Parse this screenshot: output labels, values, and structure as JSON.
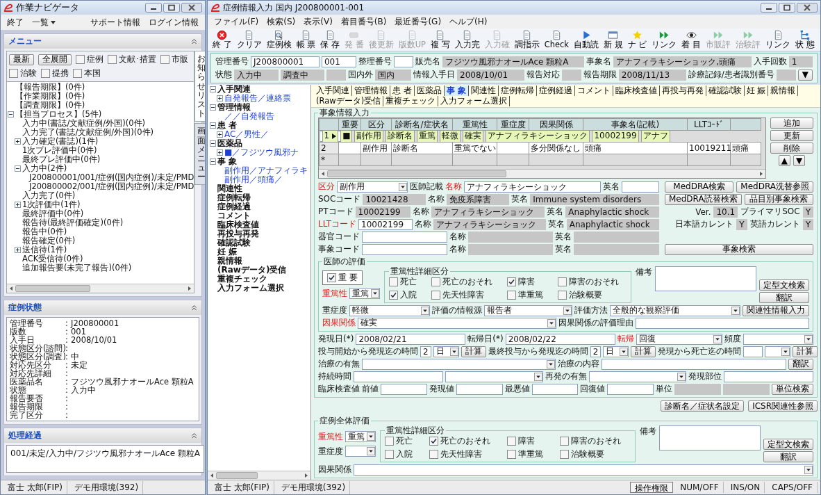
{
  "nav_window": {
    "title": "作業ナビゲータ",
    "menu": [
      {
        "kind": "item",
        "text": "終了"
      },
      {
        "kind": "dropdown",
        "text": "一覧"
      }
    ],
    "links": [
      "サポート情報",
      "ログイン情報"
    ],
    "menu_panel": {
      "title": "メニュー",
      "buttons": [
        "最新",
        "全展開"
      ],
      "filters": [
        {
          "label": "症例",
          "checked": false
        },
        {
          "label": "文献･措置",
          "checked": false
        },
        {
          "label": "市販",
          "checked": false
        },
        {
          "label": "治験",
          "checked": false
        },
        {
          "label": "提携",
          "checked": false
        },
        {
          "label": "本国",
          "checked": false
        }
      ],
      "side_tabs": [
        {
          "label": "お知らせリスト",
          "selected": true
        },
        {
          "label": "画面メニュー",
          "selected": false
        }
      ],
      "tree": [
        {
          "kind": "leaf",
          "text": "【報告期限】(0件)"
        },
        {
          "kind": "leaf",
          "text": "【作業期限】(0件)"
        },
        {
          "kind": "leaf",
          "text": "【調査期限】(0件)"
        },
        {
          "kind": "node",
          "text": "【担当プロセス】(5件)",
          "expanded": true,
          "children": [
            {
              "kind": "leaf",
              "text": "入力中(書誌/文献症例/外国)(0件)"
            },
            {
              "kind": "leaf",
              "text": "入力完了(書誌/文献症例/外国)(0件)"
            },
            {
              "kind": "node",
              "text": "入力確定(書誌)(1件)",
              "expanded": false
            },
            {
              "kind": "leaf",
              "text": "1次プレ評価中(0件)"
            },
            {
              "kind": "leaf",
              "text": "最終プレ評価中(0件)"
            },
            {
              "kind": "node",
              "text": "入力中(2件)",
              "expanded": true,
              "children": [
                {
                  "kind": "leaf",
                  "text": "J200800001/001/症例(国内症例)/未定/PMD"
                },
                {
                  "kind": "leaf",
                  "text": "J200800002/001/症例(国内症例)/未定/PMD"
                }
              ]
            },
            {
              "kind": "leaf",
              "text": "入力完了(0件)"
            },
            {
              "kind": "node",
              "text": "1次評価中(1件)",
              "expanded": false
            },
            {
              "kind": "leaf",
              "text": "最終評価中(0件)"
            },
            {
              "kind": "leaf",
              "text": "報告待(最終評価確定)(0件)"
            },
            {
              "kind": "leaf",
              "text": "報告中(0件)"
            },
            {
              "kind": "leaf",
              "text": "報告確定(0件)"
            },
            {
              "kind": "node",
              "text": "送信待(1件)",
              "expanded": false
            },
            {
              "kind": "leaf",
              "text": "ACK受信待(0件)"
            },
            {
              "kind": "leaf",
              "text": "追加報告要(未完了報告)(0件)"
            }
          ]
        }
      ]
    },
    "case_status": {
      "title": "症例状態",
      "rows": [
        {
          "label": "管理番号",
          "sep": ":",
          "value": "J200800001"
        },
        {
          "label": "版数",
          "sep": ":",
          "value": "001"
        },
        {
          "label": "入手日",
          "sep": ":",
          "value": "2008/10/01"
        },
        {
          "label": "状態区分(諮問)",
          "sep": ":"
        },
        {
          "label": "状態区分(調査)",
          "sep": ":",
          "value": "中"
        },
        {
          "label": "対応先区分",
          "sep": ":",
          "value": "未定"
        },
        {
          "label": "対応先詳細",
          "sep": ":"
        },
        {
          "label": "医薬品名",
          "sep": ":",
          "value": "フジツウ風邪ナオールAce 顆粒A"
        },
        {
          "label": "状態",
          "sep": ":",
          "value": "入力中"
        },
        {
          "label": "報告要否",
          "sep": ":"
        },
        {
          "label": "報告期限",
          "sep": ":"
        },
        {
          "label": "完了区分",
          "sep": ":"
        }
      ]
    },
    "history": {
      "title": "処理経過",
      "lines": [
        "001/未定/入力中/フジツウ風邪ナオールAce 顆粒A"
      ]
    },
    "status_bar": [
      "富士 太郎(FIP)",
      "デモ用環境(392)"
    ]
  },
  "entry_window": {
    "title": "症例情報入力 国内 J200800001-001",
    "menu": [
      "ファイル(F)",
      "検索(S)",
      "表示(V)",
      "着目番号(B)",
      "最近番号(G)",
      "ヘルプ(H)"
    ],
    "toolbar": [
      {
        "label": "終 了",
        "disabled": false
      },
      {
        "label": "クリア",
        "disabled": false
      },
      {
        "label": "症例検",
        "disabled": false
      },
      {
        "label": "帳 票",
        "disabled": false
      },
      {
        "label": "保 存",
        "disabled": false
      },
      {
        "label": "発 番",
        "disabled": true
      },
      {
        "label": "後更新",
        "disabled": true
      },
      {
        "label": "版数UP",
        "disabled": true
      },
      {
        "label": "複 写",
        "disabled": false
      },
      {
        "label": "入力完",
        "disabled": false
      },
      {
        "label": "入力確",
        "disabled": true
      },
      {
        "label": "調指示",
        "disabled": false
      },
      {
        "label": "Check",
        "disabled": false
      },
      {
        "label": "自動読",
        "disabled": false
      },
      {
        "label": "新 規",
        "disabled": false
      },
      {
        "label": "ナ ビ",
        "disabled": false
      },
      {
        "label": "リンク",
        "disabled": false
      },
      {
        "label": "着 目",
        "disabled": false
      },
      {
        "label": "市販評",
        "disabled": true
      },
      {
        "label": "治験評",
        "disabled": true
      },
      {
        "label": "リンク",
        "disabled": false
      },
      {
        "label": "状 態",
        "disabled": false
      }
    ],
    "header": [
      {
        "items": [
          {
            "kind": "label",
            "text": "管理番号"
          },
          {
            "kind": "field",
            "value": "J200800001"
          },
          {
            "kind": "field",
            "value": "001"
          },
          {
            "kind": "label",
            "text": "整理番号"
          },
          {
            "kind": "field"
          },
          {
            "kind": "label",
            "text": "販売名"
          },
          {
            "kind": "readonly",
            "value": "フジツウ風邪ナオールAce 顆粒A"
          },
          {
            "kind": "label",
            "text": "事象名"
          },
          {
            "kind": "readonly",
            "value": "アナフィラキシーショック,頭痛"
          },
          {
            "kind": "label",
            "text": "入手回数"
          },
          {
            "kind": "readonly",
            "value": "1"
          }
        ]
      },
      {
        "items": [
          {
            "kind": "label",
            "text": "状態"
          },
          {
            "kind": "readonly",
            "value": "入力中"
          },
          {
            "kind": "readonly",
            "value": "調査中"
          },
          {
            "kind": "readonly"
          },
          {
            "kind": "label",
            "text": "国内外"
          },
          {
            "kind": "readonly",
            "value": "国内"
          },
          {
            "kind": "label",
            "text": "情報入手日"
          },
          {
            "kind": "readonly",
            "value": "2008/10/01"
          },
          {
            "kind": "label",
            "text": "報告対応"
          },
          {
            "kind": "readonly"
          },
          {
            "kind": "label",
            "text": "報告期限"
          },
          {
            "kind": "readonly",
            "value": "2008/11/13"
          },
          {
            "kind": "label",
            "text": "診療記録/患者識別番号"
          },
          {
            "kind": "readonly"
          },
          {
            "kind": "button",
            "text": "▼"
          }
        ]
      }
    ],
    "nav_tree": [
      {
        "kind": "node",
        "text": "入手関連",
        "expanded": true,
        "children": [
          {
            "kind": "node",
            "text": "自発報告／連絡票",
            "expanded": false
          }
        ]
      },
      {
        "kind": "node",
        "text": "管理情報",
        "expanded": true,
        "children": [
          {
            "kind": "leaf",
            "text": "／／自発報告"
          }
        ]
      },
      {
        "kind": "node",
        "text": "患 者",
        "expanded": true,
        "children": [
          {
            "kind": "node",
            "text": "AC／男性／",
            "expanded": false
          }
        ]
      },
      {
        "kind": "node",
        "text": "医薬品",
        "expanded": true,
        "children": [
          {
            "kind": "node",
            "text": "■／フジツウ風邪ナ",
            "expanded": false
          }
        ]
      },
      {
        "kind": "node",
        "text": "事 象",
        "expanded": true,
        "children": [
          {
            "kind": "leaf",
            "text": "副作用／アナフィラキ"
          },
          {
            "kind": "leaf",
            "text": "副作用／頭痛／"
          }
        ]
      },
      {
        "kind": "leaf",
        "text": "関連性"
      },
      {
        "kind": "leaf",
        "text": "症例転帰"
      },
      {
        "kind": "leaf",
        "text": "症例経過"
      },
      {
        "kind": "leaf",
        "text": "コメント"
      },
      {
        "kind": "leaf",
        "text": "臨床検査値"
      },
      {
        "kind": "leaf",
        "text": "再投与再発"
      },
      {
        "kind": "leaf",
        "text": "確認試験"
      },
      {
        "kind": "leaf",
        "text": "妊 娠"
      },
      {
        "kind": "leaf",
        "text": "親情報"
      },
      {
        "kind": "leaf",
        "text": "(Rawデータ)受信"
      },
      {
        "kind": "leaf",
        "text": "重複チェック"
      },
      {
        "kind": "leaf",
        "text": "入力フォーム選択"
      }
    ],
    "tabs": [
      {
        "label": "入手関連",
        "selected": false
      },
      {
        "label": "管理情報",
        "selected": false
      },
      {
        "label": "患 者",
        "selected": false
      },
      {
        "label": "医薬品",
        "selected": false
      },
      {
        "label": "事 象",
        "selected": true
      },
      {
        "label": "関連性",
        "selected": false
      },
      {
        "label": "症例転帰",
        "selected": false
      },
      {
        "label": "症例経過",
        "selected": false
      },
      {
        "label": "コメント",
        "selected": false
      },
      {
        "label": "臨床検査値",
        "selected": false
      },
      {
        "label": "再投与再発",
        "selected": false
      },
      {
        "label": "確認試験",
        "selected": false
      },
      {
        "label": "妊 娠",
        "selected": false
      },
      {
        "label": "親情報",
        "selected": false
      },
      {
        "label": "(Rawデータ)受信",
        "selected": false
      },
      {
        "label": "重複チェック",
        "selected": false
      },
      {
        "label": "入力フォーム選択",
        "selected": false
      }
    ],
    "event_group": {
      "title": "事象情報入力",
      "table": {
        "columns": [
          "重要",
          "区分",
          "診断名/症状名",
          "重篤性",
          "重症度",
          "因果関係",
          "事象名(記載)",
          "LLTｺｰﾄﾞ"
        ],
        "rows": [
          {
            "kind": "row",
            "number": "1",
            "selected": true,
            "cells": [
              "■",
              "副作用",
              "診断名",
              "重篤",
              "軽微",
              "確実",
              "アナフィラキシーショック",
              "10002199",
              "アナフ"
            ]
          },
          {
            "kind": "row",
            "number": "2",
            "selected": false,
            "cells": [
              null,
              "副作用",
              "診断名",
              "重篤でない",
              null,
              "多分関係なし",
              "頭痛",
              "10019211",
              "頭痛"
            ]
          },
          {
            "kind": "new",
            "number": "*",
            "selected": false
          }
        ]
      },
      "table_buttons": [
        "追加",
        "更新",
        "削除"
      ],
      "move_buttons": [
        "▲",
        "▼"
      ],
      "rows": [
        {
          "items": [
            {
              "kind": "req-label",
              "text": "区分"
            },
            {
              "kind": "select",
              "value": "副作用"
            },
            {
              "kind": "label",
              "text": "医師記載"
            },
            {
              "kind": "req-label",
              "text": "名称"
            },
            {
              "kind": "field",
              "value": "アナフィラキシーショック"
            },
            {
              "kind": "label",
              "text": "英名"
            },
            {
              "kind": "field"
            }
          ],
          "side": [
            {
              "kind": "button",
              "text": "MedDRA検索"
            },
            {
              "kind": "button",
              "text": "MedDRA洗替参照"
            }
          ]
        },
        {
          "items": [
            {
              "kind": "label",
              "text": "SOCコード"
            },
            {
              "kind": "readonly",
              "value": "10021428"
            },
            {
              "kind": "label",
              "text": "名称"
            },
            {
              "kind": "readonly",
              "value": "免疫系障害"
            },
            {
              "kind": "label",
              "text": "英名"
            },
            {
              "kind": "readonly",
              "value": "Immune system disorders"
            }
          ],
          "side": [
            {
              "kind": "button",
              "text": "MedDRA読替検索"
            },
            {
              "kind": "button",
              "text": "品目別事象検索"
            }
          ]
        },
        {
          "items": [
            {
              "kind": "label",
              "text": "PTコード"
            },
            {
              "kind": "readonly",
              "value": "10002199"
            },
            {
              "kind": "label",
              "text": "名称"
            },
            {
              "kind": "readonly",
              "value": "アナフィラキシーショック"
            },
            {
              "kind": "label",
              "text": "英名"
            },
            {
              "kind": "readonly",
              "value": "Anaphylactic shock"
            }
          ],
          "side": [
            {
              "kind": "label",
              "text": "Ver."
            },
            {
              "kind": "readonly",
              "value": "10.1"
            },
            {
              "kind": "label",
              "text": "プライマリSOC"
            },
            {
              "kind": "readonly",
              "value": "Y"
            }
          ]
        },
        {
          "items": [
            {
              "kind": "req-label",
              "text": "LLTコード"
            },
            {
              "kind": "field",
              "value": "10002199"
            },
            {
              "kind": "label",
              "text": "名称"
            },
            {
              "kind": "readonly",
              "value": "アナフィラキシーショック"
            },
            {
              "kind": "label",
              "text": "英名"
            },
            {
              "kind": "readonly",
              "value": "Anaphylactic shock"
            }
          ],
          "side": [
            {
              "kind": "label",
              "text": "日本語カレント"
            },
            {
              "kind": "readonly",
              "value": "Y"
            },
            {
              "kind": "label",
              "text": "英語カレント"
            },
            {
              "kind": "readonly",
              "value": "Y"
            }
          ]
        },
        {
          "items": [
            {
              "kind": "label",
              "text": "器官コード"
            },
            {
              "kind": "field"
            },
            {
              "kind": "label",
              "text": "名称"
            },
            {
              "kind": "readonly"
            },
            {
              "kind": "label",
              "text": "英名"
            },
            {
              "kind": "readonly"
            }
          ],
          "side": []
        },
        {
          "items": [
            {
              "kind": "label",
              "text": "事象コード"
            },
            {
              "kind": "field"
            },
            {
              "kind": "label",
              "text": "名称"
            },
            {
              "kind": "readonly"
            },
            {
              "kind": "label",
              "text": "英名"
            },
            {
              "kind": "readonly"
            }
          ],
          "side": [
            {
              "kind": "button",
              "text": "事象検索"
            }
          ]
        }
      ],
      "doctor_eval": {
        "title": "医師の評価",
        "left": [
          {
            "items": [
              {
                "kind": "check",
                "text": "重 要",
                "checked": true
              }
            ]
          },
          {
            "items": [
              {
                "kind": "req-label",
                "text": "重篤性"
              },
              {
                "kind": "select",
                "value": "重篤"
              }
            ]
          }
        ],
        "detail": {
          "title": "重篤性詳細区分",
          "checks": [
            {
              "label": "死亡",
              "checked": false
            },
            {
              "label": "死亡のおそれ",
              "checked": false
            },
            {
              "label": "障害",
              "checked": true
            },
            {
              "label": "障害のおそれ",
              "checked": false
            },
            {
              "label": "入院",
              "checked": true
            },
            {
              "label": "先天性障害",
              "checked": false
            },
            {
              "label": "準重篤",
              "checked": false
            },
            {
              "label": "治験概要",
              "checked": false
            }
          ]
        },
        "remarks": {
          "label": "備考",
          "buttons": [
            "定型文検索",
            "翻訳"
          ]
        },
        "rows": [
          {
            "items": [
              {
                "kind": "label",
                "text": "重症度"
              },
              {
                "kind": "select",
                "value": "軽微"
              },
              {
                "kind": "label",
                "text": "評価の情報源"
              },
              {
                "kind": "select",
                "value": "報告者"
              },
              {
                "kind": "label",
                "text": "評価方法"
              },
              {
                "kind": "select",
                "value": "全般的な観察評価"
              },
              {
                "kind": "button",
                "text": "関連性情報入力"
              }
            ]
          },
          {
            "items": [
              {
                "kind": "req-label",
                "text": "因果関係"
              },
              {
                "kind": "select",
                "value": "確実"
              },
              {
                "kind": "label",
                "text": "因果関係の評価理由"
              },
              {
                "kind": "field"
              }
            ]
          }
        ]
      },
      "more_rows": [
        {
          "items": [
            {
              "kind": "label",
              "text": "発現日(*)"
            },
            {
              "kind": "field",
              "value": "2008/02/21"
            },
            {
              "kind": "label",
              "text": "転帰日(*)"
            },
            {
              "kind": "field",
              "value": "2008/02/22"
            },
            {
              "kind": "req-label",
              "text": "転帰"
            },
            {
              "kind": "select",
              "value": "回復"
            },
            {
              "kind": "label",
              "text": "頻度"
            },
            {
              "kind": "select"
            }
          ]
        },
        {
          "items": [
            {
              "kind": "label",
              "text": "投与開始から発現迄の時間"
            },
            {
              "kind": "field",
              "value": "2"
            },
            {
              "kind": "select",
              "value": "日"
            },
            {
              "kind": "button",
              "text": "計算"
            },
            {
              "kind": "label",
              "text": "最終投与から発現迄の時間"
            },
            {
              "kind": "field",
              "value": "2"
            },
            {
              "kind": "select",
              "value": "日"
            },
            {
              "kind": "button",
              "text": "計算"
            },
            {
              "kind": "label",
              "text": "発現から死亡迄の時間"
            },
            {
              "kind": "field"
            },
            {
              "kind": "select"
            },
            {
              "kind": "button",
              "text": "計算"
            }
          ]
        },
        {
          "items": [
            {
              "kind": "label",
              "text": "治療の有無"
            },
            {
              "kind": "select"
            },
            {
              "kind": "label",
              "text": "治療の内容"
            },
            {
              "kind": "field"
            },
            {
              "kind": "button",
              "text": "翻訳"
            }
          ]
        },
        {
          "items": [
            {
              "kind": "label",
              "text": "持続時間"
            },
            {
              "kind": "field"
            },
            {
              "kind": "select"
            },
            {
              "kind": "label",
              "text": "再発の有無"
            },
            {
              "kind": "select"
            },
            {
              "kind": "label",
              "text": "発現部位"
            },
            {
              "kind": "field"
            }
          ]
        },
        {
          "items": [
            {
              "kind": "label",
              "text": "臨床検査値"
            },
            {
              "kind": "label",
              "text": "前値"
            },
            {
              "kind": "field"
            },
            {
              "kind": "label",
              "text": "発現値"
            },
            {
              "kind": "field"
            },
            {
              "kind": "label",
              "text": "最悪値"
            },
            {
              "kind": "field"
            },
            {
              "kind": "label",
              "text": "回復値"
            },
            {
              "kind": "field"
            },
            {
              "kind": "label",
              "text": "単位"
            },
            {
              "kind": "readonly"
            },
            {
              "kind": "readonly"
            },
            {
              "kind": "button",
              "text": "単位検索"
            }
          ]
        }
      ]
    },
    "action_buttons": [
      "診断名／症状名設定",
      "ICSR関連性参照"
    ],
    "case_eval": {
      "title": "症例全体評価",
      "left": [
        {
          "items": [
            {
              "kind": "req-label",
              "text": "重篤性"
            },
            {
              "kind": "select",
              "value": "重篤"
            }
          ]
        },
        {
          "items": [
            {
              "kind": "label",
              "text": "重症度"
            },
            {
              "kind": "select"
            }
          ]
        }
      ],
      "detail": {
        "title": "重篤性詳細区分",
        "checks": [
          {
            "label": "死亡",
            "checked": false
          },
          {
            "label": "死亡のおそれ",
            "checked": true
          },
          {
            "label": "障害",
            "checked": false
          },
          {
            "label": "障害のおそれ",
            "checked": false
          },
          {
            "label": "入院",
            "checked": false
          },
          {
            "label": "先天性障害",
            "checked": false
          },
          {
            "label": "準重篤",
            "checked": false
          },
          {
            "label": "治験概要",
            "checked": false
          }
        ]
      },
      "remarks": {
        "label": "備考",
        "buttons": [
          "定型文検索",
          "翻訳"
        ]
      },
      "rows": [
        {
          "items": [
            {
              "kind": "label",
              "text": "因果関係"
            },
            {
              "kind": "select"
            }
          ]
        }
      ]
    },
    "status_bar": [
      {
        "kind": "text",
        "text": "富士 太郎(FIP)"
      },
      {
        "kind": "text",
        "text": "デモ用環境(392)"
      },
      {
        "kind": "button",
        "text": "操作権限"
      },
      {
        "kind": "text",
        "text": "NUM/OFF"
      },
      {
        "kind": "text",
        "text": "INS/ON"
      },
      {
        "kind": "text",
        "text": "CAPS/OFF"
      }
    ]
  }
}
